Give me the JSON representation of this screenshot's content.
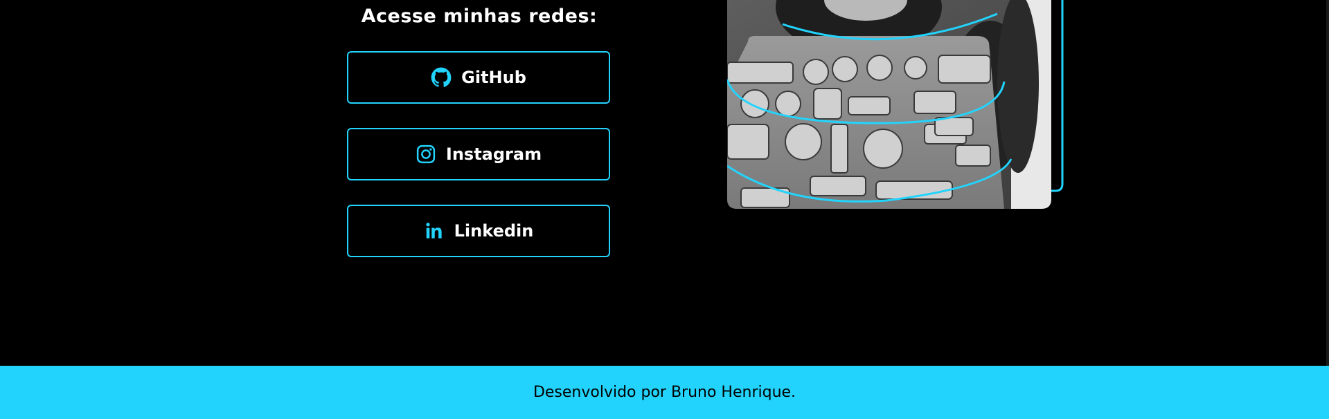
{
  "links": {
    "title": "Acesse minhas redes:",
    "items": [
      {
        "label": "GitHub",
        "icon": "github-icon"
      },
      {
        "label": "Instagram",
        "icon": "instagram-icon"
      },
      {
        "label": "Linkedin",
        "icon": "linkedin-icon"
      }
    ]
  },
  "photo": {
    "alt_description": "profile-photo"
  },
  "footer": {
    "text": "Desenvolvido por Bruno Henrique."
  },
  "colors": {
    "background": "#000000",
    "accent": "#22d4fd",
    "text": "#ffffff",
    "footer_text": "#000000"
  }
}
